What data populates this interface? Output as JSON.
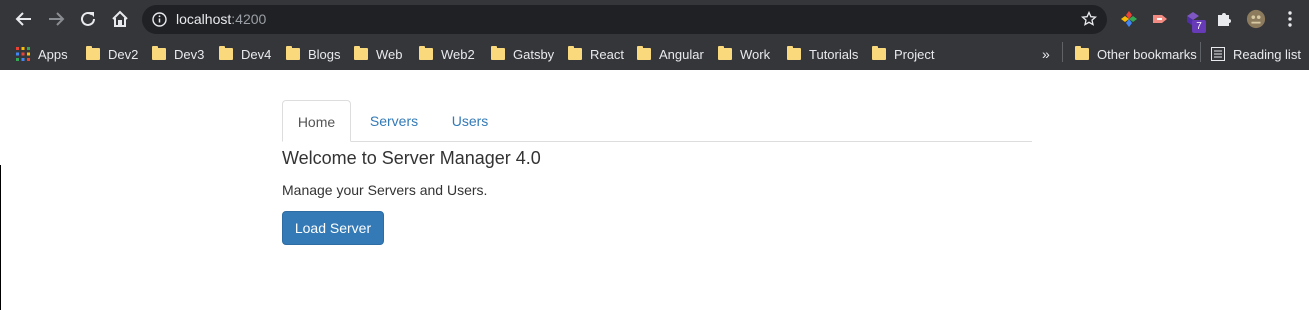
{
  "browser": {
    "url_host": "localhost",
    "url_port": ":4200",
    "extension_badge": "7"
  },
  "bookmarks": {
    "apps": "Apps",
    "items": [
      "Dev2",
      "Dev3",
      "Dev4",
      "Blogs",
      "Web",
      "Web2",
      "Gatsby",
      "React",
      "Angular",
      "Work",
      "Tutorials",
      "Project"
    ],
    "overflow": "»",
    "other": "Other bookmarks",
    "reading_list": "Reading list"
  },
  "app": {
    "tabs": [
      {
        "label": "Home",
        "active": true
      },
      {
        "label": "Servers",
        "active": false
      },
      {
        "label": "Users",
        "active": false
      }
    ],
    "welcome": "Welcome to Server Manager 4.0",
    "subtitle": "Manage your Servers and Users.",
    "load_button": "Load Server"
  },
  "colors": {
    "chrome_dark": "#35363a",
    "omnibox": "#202124",
    "link": "#337ab7",
    "primary_button": "#337ab7"
  }
}
